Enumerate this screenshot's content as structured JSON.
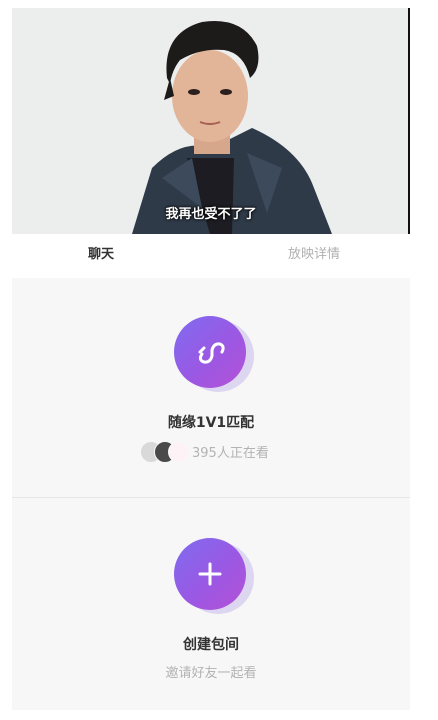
{
  "video": {
    "subtitle": "我再也受不了了"
  },
  "tabs": {
    "chat": "聊天",
    "details": "放映详情"
  },
  "random_match": {
    "title": "随缘1V1匹配",
    "viewer_text": "395人正在看",
    "icon": "infinity-icon"
  },
  "create_room": {
    "title": "创建包间",
    "subtitle": "邀请好友一起看",
    "icon": "plus-icon"
  },
  "colors": {
    "accent_start": "#7f6cf0",
    "accent_end": "#b551d6",
    "muted_text": "#b3b3b3"
  }
}
